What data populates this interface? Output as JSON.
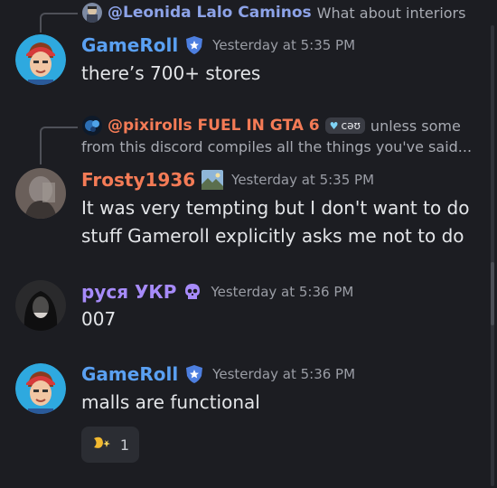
{
  "colors": {
    "background": "#1c1d22",
    "gameroll_name": "#5aa0f2",
    "frosty_name": "#f47b56",
    "rusya_name": "#a78bfa",
    "leonida_name": "#8da3e8",
    "pixirolls_name": "#f47b56",
    "timestamp": "#9a9da5"
  },
  "replies": [
    {
      "name": "@Leonida Lalo Caminos",
      "text": "What about interiors",
      "avatar_icon": "leonida-avatar"
    },
    {
      "name": "@pixirolls FUEL IN GTA 6",
      "tag": "сəʊ",
      "text_line1": "unless some",
      "text_line2": "from this discord compiles all the things you've said...",
      "avatar_icon": "pixirolls-avatar"
    }
  ],
  "messages": [
    {
      "author": "GameRoll",
      "badge_icon": "shield-star-icon",
      "timestamp": "Yesterday at 5:35 PM",
      "lines": [
        "there’s 700+ stores"
      ]
    },
    {
      "author": "Frosty1936",
      "badge_icon": "landscape-image-icon",
      "timestamp": "Yesterday at 5:35 PM",
      "lines": [
        "It was very tempting but I don't want to do",
        "stuff Gameroll explicitly asks me not to do"
      ]
    },
    {
      "author": "руся УКР",
      "badge_icon": "skull-icon",
      "timestamp": "Yesterday at 5:36 PM",
      "lines": [
        "007"
      ]
    },
    {
      "author": "GameRoll",
      "badge_icon": "shield-star-icon",
      "timestamp": "Yesterday at 5:36 PM",
      "lines": [
        "malls are functional"
      ]
    }
  ],
  "reaction": {
    "icon": "sparkle-emoji-icon",
    "count": "1"
  }
}
